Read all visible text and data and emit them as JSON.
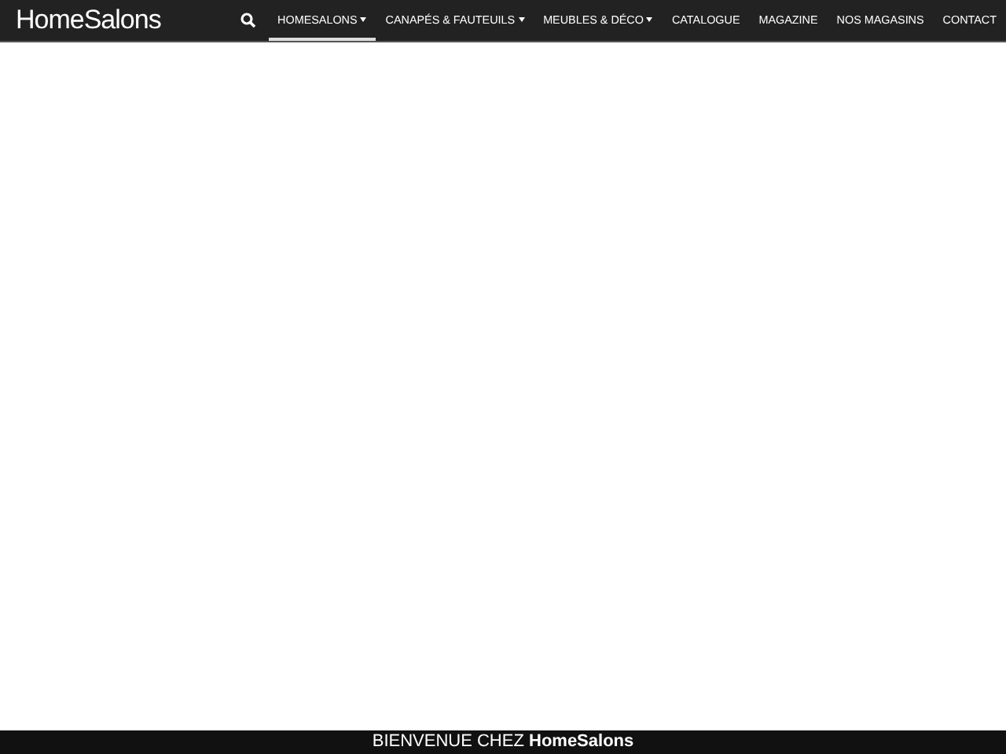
{
  "header": {
    "logo": "HomeSalons",
    "nav": [
      {
        "label": "HOMESALONS",
        "selected": true,
        "dropdown": true
      },
      {
        "label": "CANAPÉS & FAUTEUILS",
        "selected": false,
        "dropdown": true
      },
      {
        "label": "MEUBLES & DÉCO",
        "selected": false,
        "dropdown": true
      },
      {
        "label": "CATALOGUE",
        "selected": false,
        "dropdown": false
      },
      {
        "label": "MAGAZINE",
        "selected": false,
        "dropdown": false
      },
      {
        "label": "NOS MAGASINS",
        "selected": false,
        "dropdown": false
      },
      {
        "label": "CONTACT",
        "selected": false,
        "dropdown": false
      }
    ]
  },
  "footer_banner": {
    "text": "BIENVENUE CHEZ **HomeSalons**"
  }
}
